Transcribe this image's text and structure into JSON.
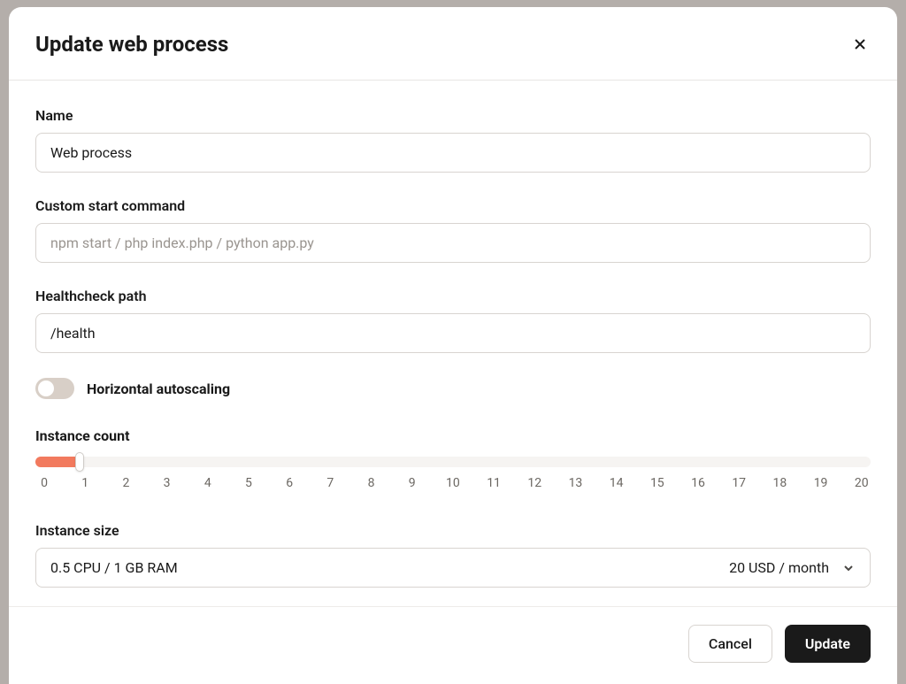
{
  "modal": {
    "title": "Update web process"
  },
  "form": {
    "name": {
      "label": "Name",
      "value": "Web process"
    },
    "start_command": {
      "label": "Custom start command",
      "placeholder": "npm start / php index.php / python app.py",
      "value": ""
    },
    "healthcheck": {
      "label": "Healthcheck path",
      "value": "/health"
    },
    "autoscaling": {
      "label": "Horizontal autoscaling",
      "enabled": false
    },
    "instance_count": {
      "label": "Instance count",
      "value": 1,
      "min": 0,
      "max": 20,
      "ticks": [
        "0",
        "1",
        "2",
        "3",
        "4",
        "5",
        "6",
        "7",
        "8",
        "9",
        "10",
        "11",
        "12",
        "13",
        "14",
        "15",
        "16",
        "17",
        "18",
        "19",
        "20"
      ]
    },
    "instance_size": {
      "label": "Instance size",
      "value": "0.5 CPU / 1 GB RAM",
      "price": "20 USD / month"
    }
  },
  "footer": {
    "cancel": "Cancel",
    "submit": "Update"
  }
}
